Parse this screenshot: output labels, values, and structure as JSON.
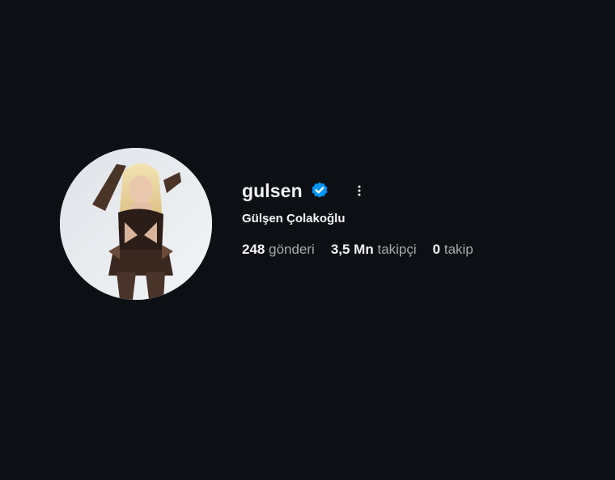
{
  "profile": {
    "username": "gulsen",
    "full_name": "Gülşen Çolakoğlu",
    "verified": true,
    "accent_color": "#0095f6",
    "avatar_icon": "profile-photo",
    "options_icon": "more-vertical-icon"
  },
  "stats": {
    "posts_count": "248",
    "posts_label": "gönderi",
    "followers_count": "3,5 Mn",
    "followers_label": "takipçi",
    "following_count": "0",
    "following_label": "takip"
  }
}
